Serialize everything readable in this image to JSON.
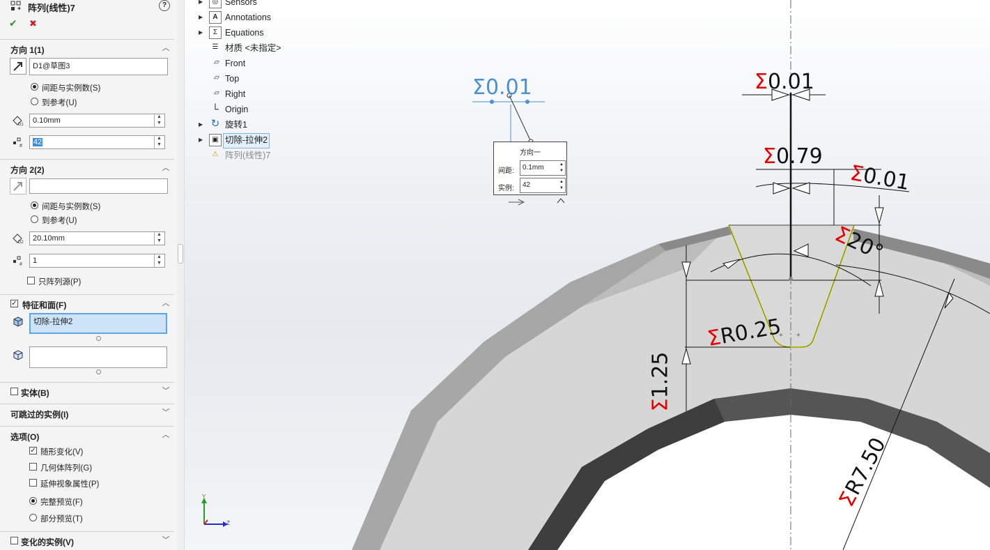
{
  "feature": {
    "title": "阵列(线性)7",
    "help": "?",
    "ok": "✔",
    "cancel": "✖"
  },
  "direction1": {
    "title": "方向 1(1)",
    "ref_value": "D1@草图3",
    "radio1": "间距与实例数(S)",
    "radio2": "到参考(U)",
    "spacing": "0.10mm",
    "instances": "42",
    "spin_up": "▲",
    "spin_down": "▼"
  },
  "direction2": {
    "title": "方向 2(2)",
    "ref_value": "",
    "radio1": "间距与实例数(S)",
    "radio2": "到参考(U)",
    "spacing": "20.10mm",
    "instances": "1",
    "seed_only": "只阵列源(P)"
  },
  "features_faces": {
    "title": "特征和面(F)",
    "feature": "切除-拉伸2"
  },
  "sections": {
    "bodies": "实体(B)",
    "skip": "可跳过的实例(I)",
    "options": "选项(O)",
    "vary": "变化的实例(V)"
  },
  "options": {
    "vary_sketch": "随形变化(V)",
    "geometry_pattern": "几何体阵列(G)",
    "propagate_visual": "延伸视象属性(P)",
    "full_preview": "完整预览(F)",
    "partial_preview": "部分预览(T)"
  },
  "tree": [
    {
      "label": "Sensors",
      "icon": "sensors-icon"
    },
    {
      "label": "Annotations",
      "icon": "annotations-icon"
    },
    {
      "label": "Equations",
      "icon": "equations-icon"
    },
    {
      "label": "材质 <未指定>",
      "icon": "material-icon"
    },
    {
      "label": "Front",
      "icon": "plane-icon"
    },
    {
      "label": "Top",
      "icon": "plane-icon"
    },
    {
      "label": "Right",
      "icon": "plane-icon"
    },
    {
      "label": "Origin",
      "icon": "origin-icon"
    },
    {
      "label": "旋转1",
      "icon": "revolve-icon"
    },
    {
      "label": "切除-拉伸2",
      "icon": "cut-extrude-icon"
    },
    {
      "label": "阵列(线性)7",
      "icon": "warning-icon"
    }
  ],
  "callout": {
    "title": "方向一",
    "spacing_label": "间距:",
    "spacing_value": "0.1mm",
    "count_label": "实例:",
    "count_value": "42"
  },
  "dimensions": {
    "sigma": "Σ",
    "d_blue": "0.01",
    "d_top": "0.01",
    "d_079": "0.79",
    "d_001b": "0.01",
    "d_angle": "20°",
    "d_r025": "R0.25",
    "d_125": "1.25",
    "d_r750": "R7.50"
  },
  "triad": {
    "y": "Y",
    "z": "Z"
  },
  "colors": {
    "accent_blue": "#4a90d9",
    "sigma_red": "#e20000",
    "ok_green": "#2a9a2a",
    "cancel_red": "#cc2222",
    "selection": "#cde3f7"
  }
}
